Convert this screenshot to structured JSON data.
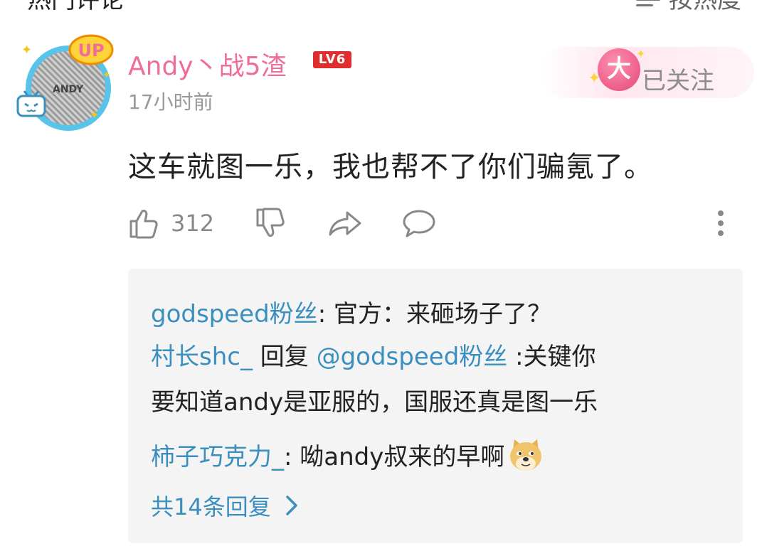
{
  "header": {
    "title": "热门评论",
    "sort_label": "按热度"
  },
  "comment": {
    "username": "Andy丶战5渣",
    "level_badge": "LV6",
    "time": "17小时前",
    "follow_badge": "大",
    "follow_label": "已关注",
    "avatar_text": "ANDY",
    "up_badge": "UP",
    "text": "这车就图一乐，我也帮不了你们骗氪了。",
    "likes": "312"
  },
  "replies": [
    {
      "user": "godspeed粉丝",
      "sep": ": ",
      "text": "官方：来砸场子了？"
    },
    {
      "user": "村长shc_",
      "mid": " 回复 ",
      "mention": "@godspeed粉丝",
      "text": " :关键你",
      "text_cont": "要知道andy是亚服的，国服还真是图一乐"
    },
    {
      "user": "柿子巧克力_",
      "sep": ": ",
      "text": "呦andy叔来的早啊",
      "emoji": "doge-emoji"
    }
  ],
  "more_replies_label": "共14条回复",
  "colors": {
    "username": "#f06d98",
    "link": "#3b8fbf",
    "level_badge": "#e02e2e",
    "reply_bg": "#f4f4f4",
    "meta": "#999999"
  }
}
